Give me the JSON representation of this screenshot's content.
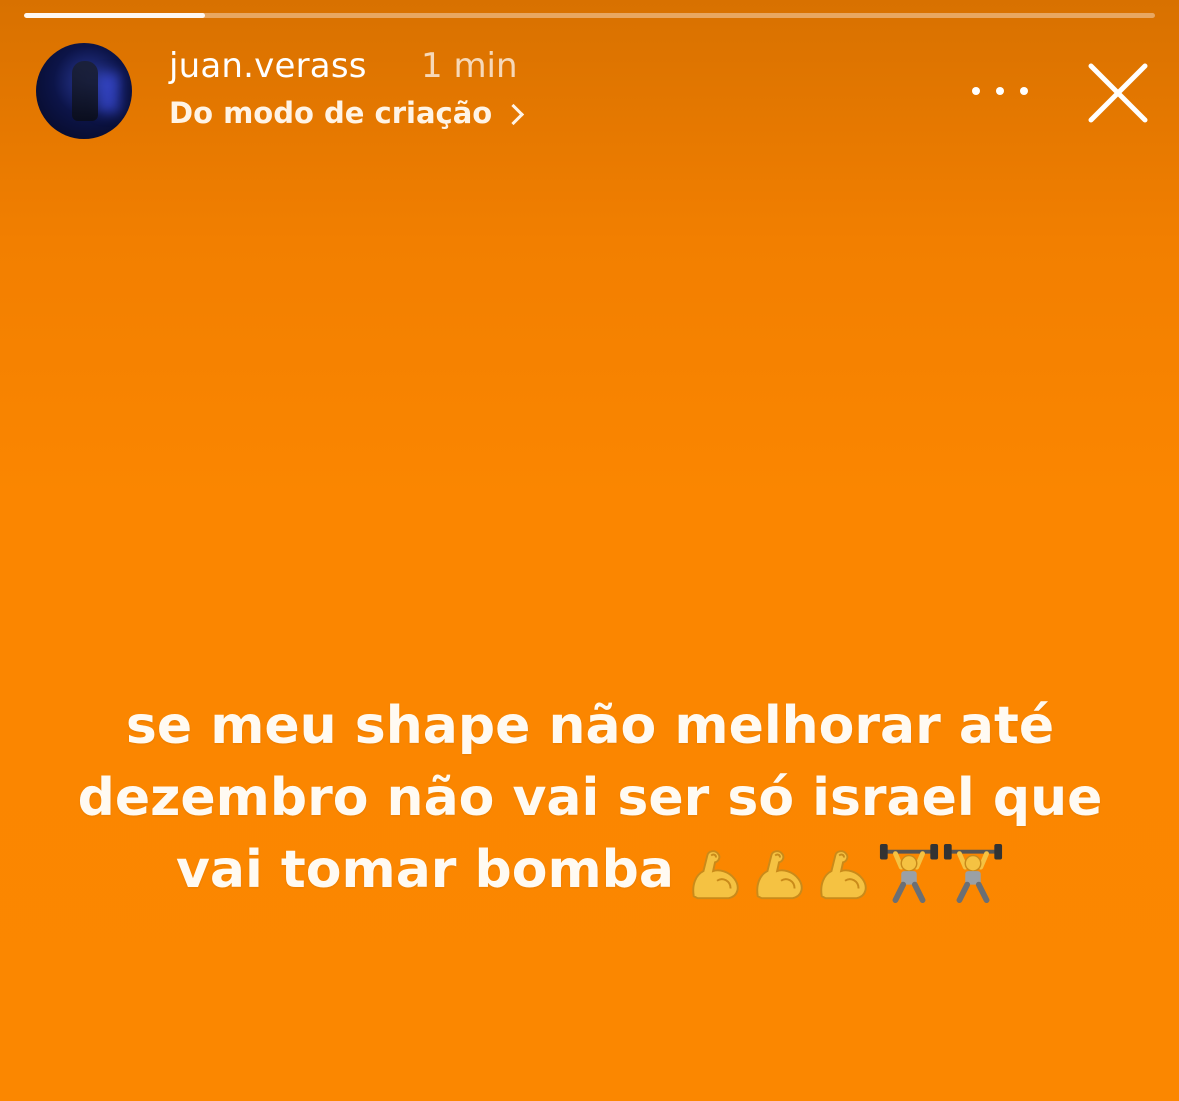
{
  "story": {
    "progress_fraction": 0.16,
    "background_color": "#fb8600",
    "header": {
      "username": "juan.verass",
      "time": "1 min",
      "subtitle": "Do modo de criação"
    },
    "caption": {
      "line1": "se meu shape não melhorar até",
      "line2": "dezembro não vai ser só israel que",
      "line3": "vai tomar bomba",
      "emojis": [
        "flexed-biceps",
        "flexed-biceps",
        "flexed-biceps",
        "weightlifter",
        "weightlifter"
      ]
    },
    "icons": {
      "more": "more-horizontal-icon",
      "close": "close-icon"
    }
  }
}
